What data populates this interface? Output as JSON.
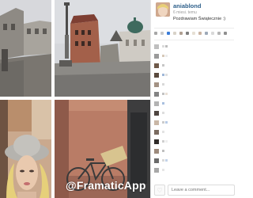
{
  "post": {
    "username": "aniablond",
    "time_ago": "6 miesi. temu",
    "caption": "Pozdrawiam Świątecznie :)"
  },
  "watermark": "@FramaticApp",
  "comment_box": {
    "placeholder": "Leave a comment..."
  },
  "icons": {
    "like": "heart-icon"
  },
  "colors": {
    "username": "#2d5f8a",
    "panel_background": "#ffffff",
    "accent_blue": "#3b7dd8"
  }
}
